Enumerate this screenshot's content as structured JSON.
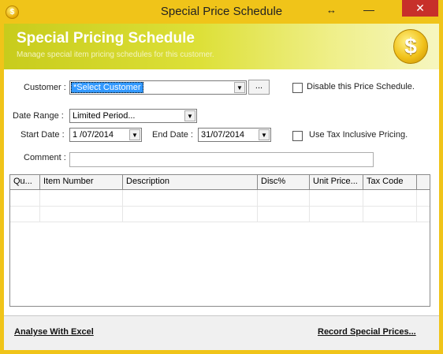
{
  "window": {
    "title": "Special Price Schedule",
    "minimize_glyph": "—",
    "close_glyph": "✕",
    "resize_glyph": "↔",
    "app_icon_glyph": "$"
  },
  "banner": {
    "heading": "Special Pricing Schedule",
    "subheading": "Manage special item pricing schedules for this customer.",
    "icon_glyph": "$"
  },
  "form": {
    "customer_label": "Customer :",
    "customer_value": "*Select Customer",
    "browse_button": "...",
    "disable_label": "Disable this Price Schedule.",
    "disable_checked": false,
    "date_range_label": "Date Range :",
    "date_range_value": "Limited Period...",
    "start_date_label": "Start Date :",
    "start_date_value": "1 /07/2014",
    "end_date_label": "End Date :",
    "end_date_value": "31/07/2014",
    "tax_inclusive_label": "Use Tax Inclusive Pricing.",
    "tax_inclusive_checked": false,
    "comment_label": "Comment :",
    "comment_value": ""
  },
  "grid": {
    "columns": [
      "Qu...",
      "Item Number",
      "Description",
      "Disc%",
      "Unit Price...",
      "Tax Code"
    ],
    "rows": [
      [
        "",
        "",
        "",
        "",
        "",
        ""
      ],
      [
        "",
        "",
        "",
        "",
        "",
        ""
      ]
    ]
  },
  "footer": {
    "analyse_link": "Analyse With Excel",
    "record_link": "Record Special Prices..."
  },
  "colors": {
    "title_bar": "#f0c419",
    "banner_start": "#c8cc1c",
    "close_button": "#c7302a",
    "selection": "#3399ff"
  }
}
